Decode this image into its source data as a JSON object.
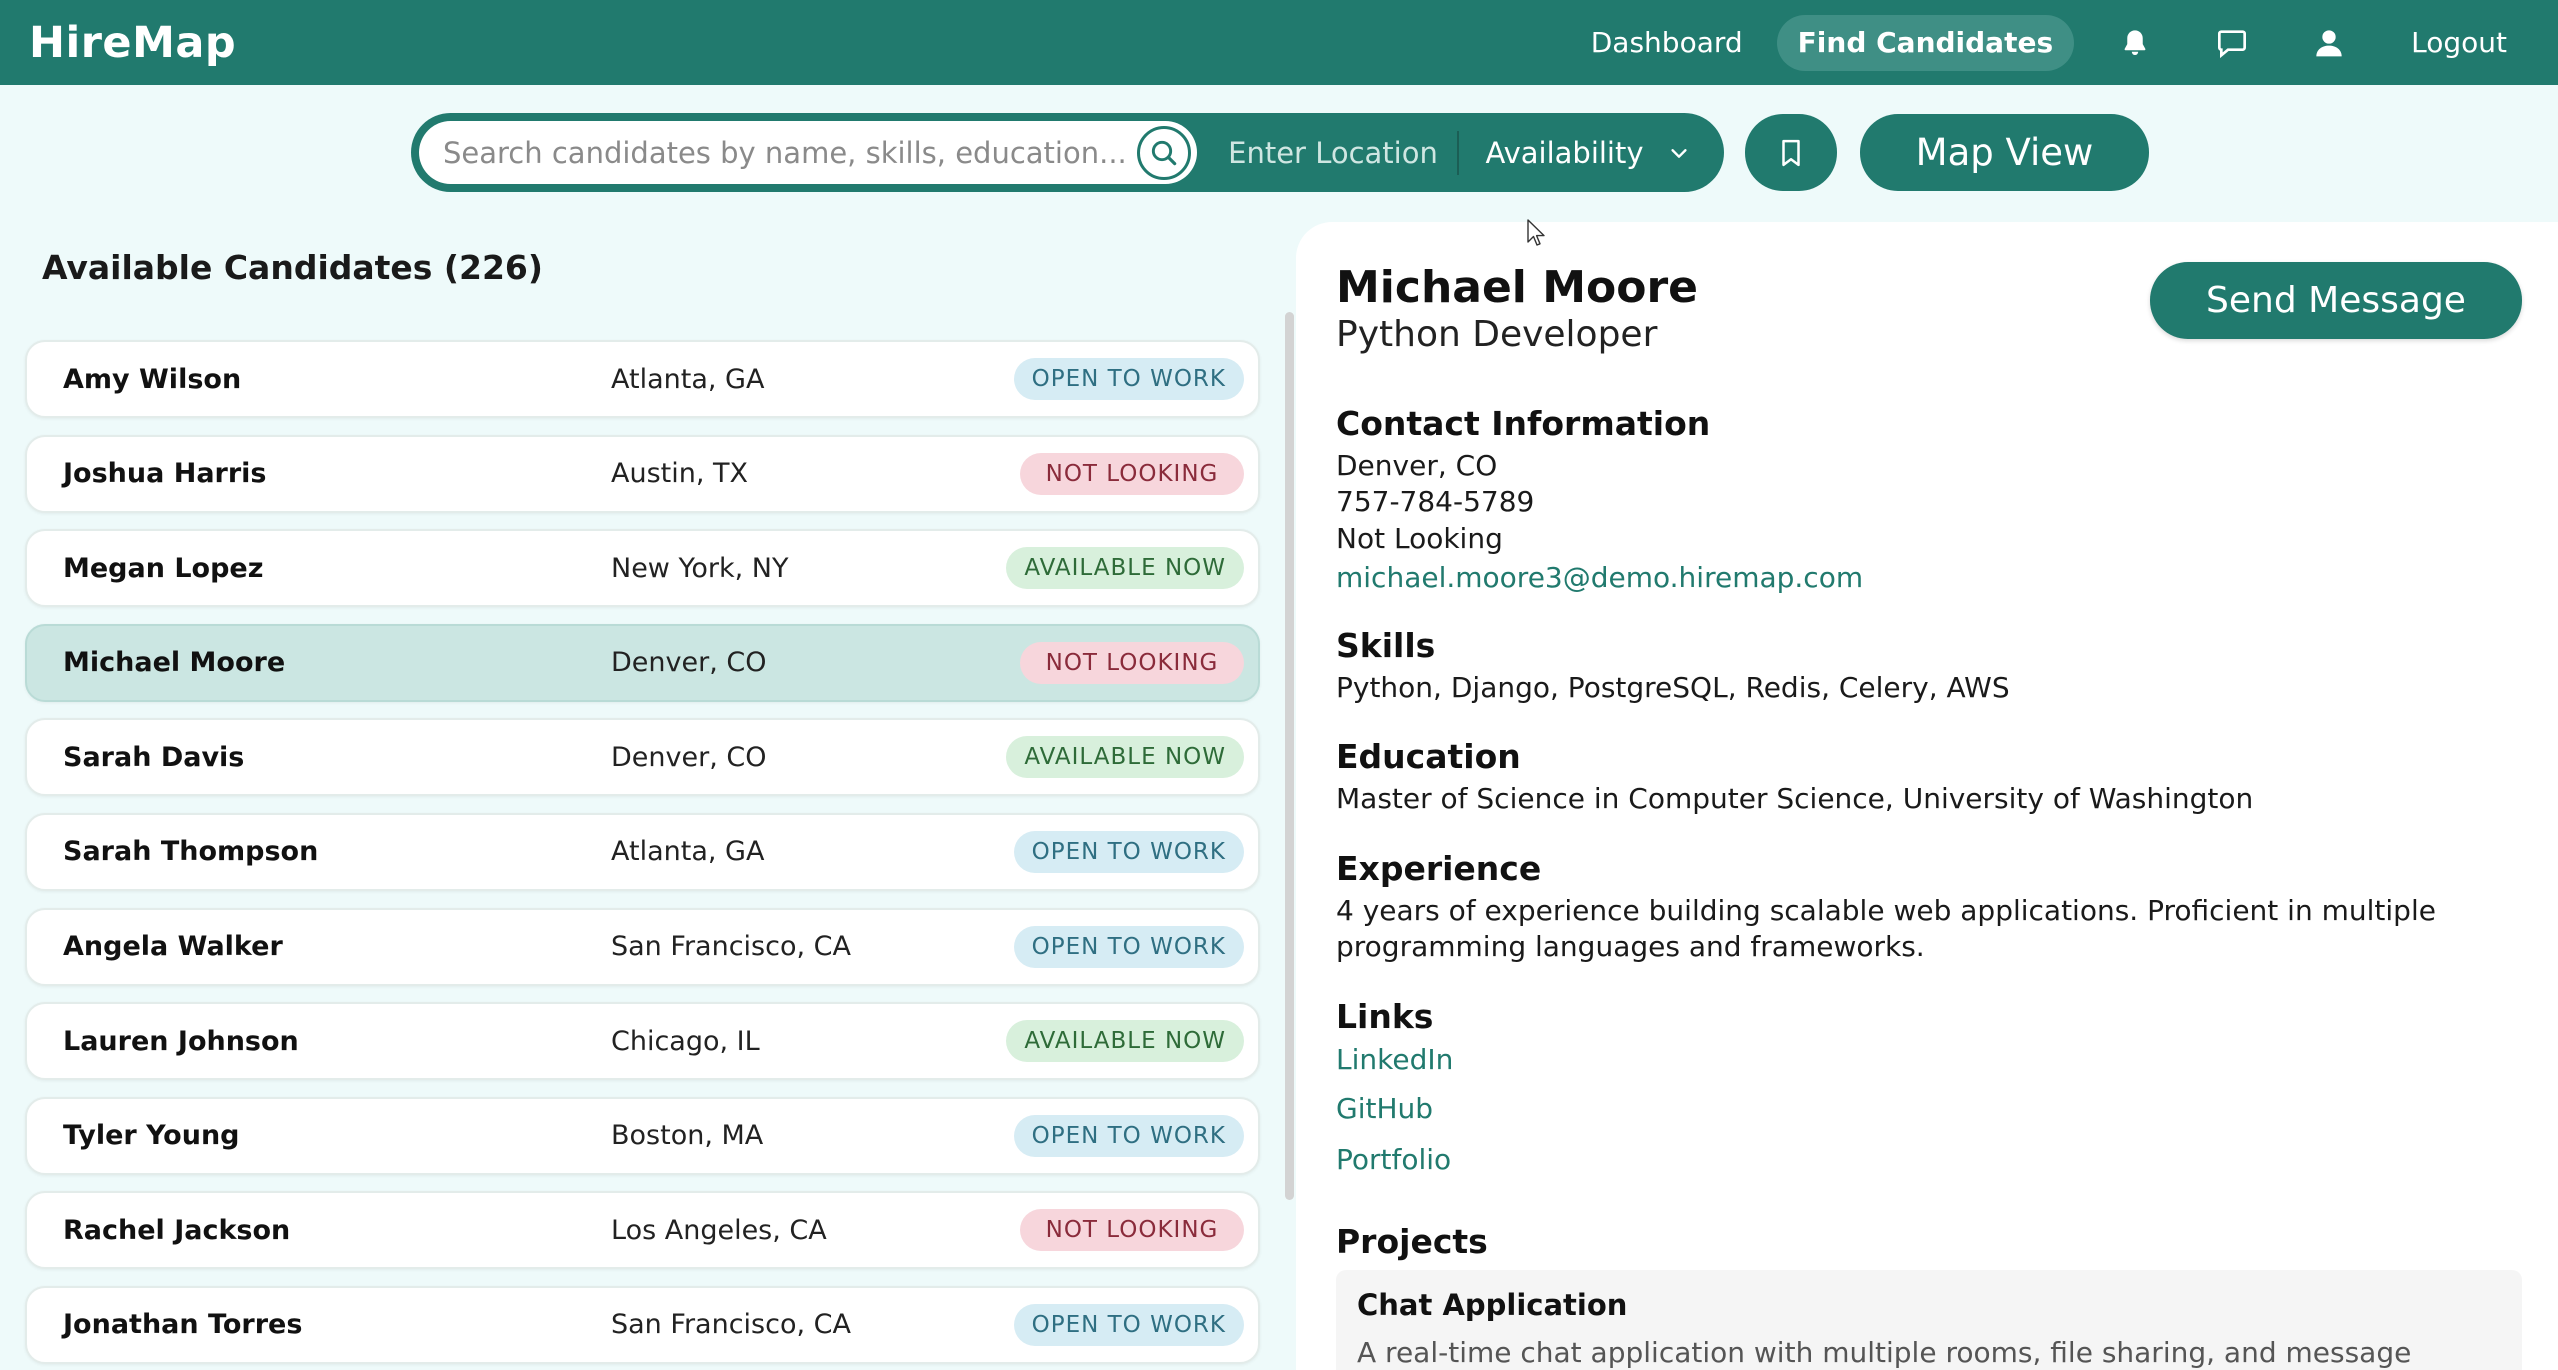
{
  "app": {
    "title": "HireMap"
  },
  "nav": {
    "dashboard": "Dashboard",
    "find_candidates": "Find Candidates",
    "logout": "Logout",
    "icons": [
      "bell-icon",
      "chat-icon",
      "user-icon"
    ]
  },
  "search": {
    "placeholder": "Search candidates by name, skills, education...",
    "value": "",
    "location_placeholder": "Enter Location",
    "availability_label": "Availability",
    "map_view_label": "Map View"
  },
  "list": {
    "title": "Available Candidates (226)",
    "candidates": [
      {
        "name": "Amy Wilson",
        "location": "Atlanta, GA",
        "status": "OPEN TO WORK"
      },
      {
        "name": "Joshua Harris",
        "location": "Austin, TX",
        "status": "NOT LOOKING"
      },
      {
        "name": "Megan Lopez",
        "location": "New York, NY",
        "status": "AVAILABLE NOW"
      },
      {
        "name": "Michael Moore",
        "location": "Denver, CO",
        "status": "NOT LOOKING"
      },
      {
        "name": "Sarah Davis",
        "location": "Denver, CO",
        "status": "AVAILABLE NOW"
      },
      {
        "name": "Sarah Thompson",
        "location": "Atlanta, GA",
        "status": "OPEN TO WORK"
      },
      {
        "name": "Angela Walker",
        "location": "San Francisco, CA",
        "status": "OPEN TO WORK"
      },
      {
        "name": "Lauren Johnson",
        "location": "Chicago, IL",
        "status": "AVAILABLE NOW"
      },
      {
        "name": "Tyler Young",
        "location": "Boston, MA",
        "status": "OPEN TO WORK"
      },
      {
        "name": "Rachel Jackson",
        "location": "Los Angeles, CA",
        "status": "NOT LOOKING"
      },
      {
        "name": "Jonathan Torres",
        "location": "San Francisco, CA",
        "status": "OPEN TO WORK"
      }
    ]
  },
  "detail": {
    "name": "Michael Moore",
    "role": "Python Developer",
    "send_message_label": "Send Message",
    "contact_heading": "Contact Information",
    "location": "Denver, CO",
    "phone": "757-784-5789",
    "status": "Not Looking",
    "email": "michael.moore3@demo.hiremap.com",
    "skills_heading": "Skills",
    "skills": "Python, Django, PostgreSQL, Redis, Celery, AWS",
    "education_heading": "Education",
    "education": "Master of Science in Computer Science, University of Washington",
    "experience_heading": "Experience",
    "experience_line1": "4 years of experience building scalable web applications. Proficient in multiple",
    "experience_line2": "programming languages and frameworks.",
    "links_heading": "Links",
    "link_linkedin": "LinkedIn",
    "link_github": "GitHub",
    "link_portfolio": "Portfolio",
    "projects_heading": "Projects",
    "project_title": "Chat Application",
    "project_desc": "A real-time chat application with multiple rooms, file sharing, and message"
  },
  "colors": {
    "brand": "#217a6e",
    "background": "#eefafa",
    "selected_row": "#cbe6e2",
    "open_badge": "#d6ecf4",
    "not_looking_badge": "#f7d6dc",
    "available_badge": "#d8f0dc"
  }
}
